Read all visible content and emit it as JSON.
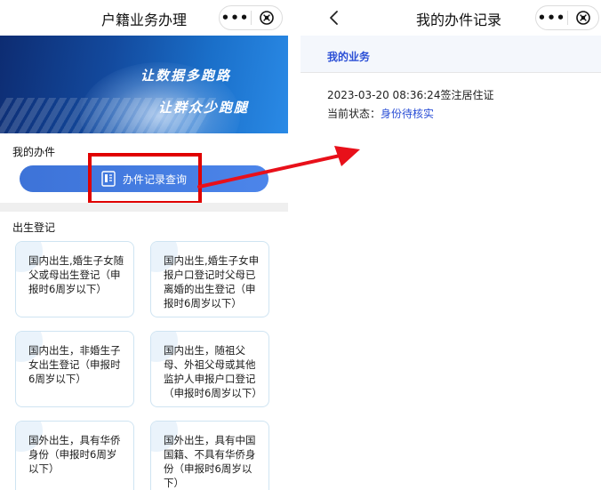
{
  "left_screen": {
    "title": "户籍业务办理",
    "capsule": {
      "more_icon": "more-dots-icon",
      "close_icon": "circle-close-icon"
    },
    "banner": {
      "line1": "让数据多跑路",
      "line2": "让群众少跑腿"
    },
    "my_section": {
      "label": "我的办件",
      "button_label": "办件记录查询",
      "button_icon": "document-icon"
    },
    "birth_section": {
      "label": "出生登记",
      "cards": [
        "国内出生,婚生子女随父或母出生登记（申报时6周岁以下）",
        "国内出生,婚生子女申报户口登记时父母已离婚的出生登记（申报时6周岁以下）",
        "国内出生，非婚生子女出生登记（申报时6周岁以下）",
        "国内出生，随祖父母、外祖父母或其他监护人申报户口登记（申报时6周岁以下）",
        "国外出生，具有华侨身份（申报时6周岁以下）",
        "国外出生，具有中国国籍、不具有华侨身份（申报时6周岁以下）"
      ]
    }
  },
  "right_screen": {
    "title": "我的办件记录",
    "back_icon": "chevron-left-icon",
    "section_title": "我的业务",
    "record": {
      "datetime_type": "2023-03-20 08:36:24签注居住证",
      "status_label": "当前状态：",
      "status_value": "身份待核实"
    }
  },
  "annotation": {
    "highlight_color": "#e00000",
    "arrow_color": "#e8101a"
  },
  "colors": {
    "accent_blue": "#2b4fd6",
    "button_blue": "#4177e0",
    "card_border": "#cfe4f2"
  }
}
